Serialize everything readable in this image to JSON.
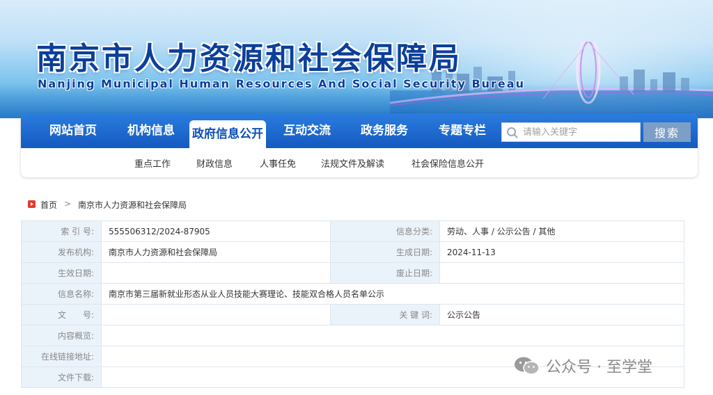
{
  "banner": {
    "title": "南京市人力资源和社会保障局",
    "subtitle": "Nanjing Municipal Human Resources And Social Security Bureau"
  },
  "nav": {
    "items": [
      "网站首页",
      "机构信息",
      "政府信息公开",
      "互动交流",
      "政务服务",
      "专题专栏"
    ],
    "active": "政府信息公开",
    "search_placeholder": "请输入关键字",
    "search_button": "搜索"
  },
  "subnav": {
    "items": [
      "重点工作",
      "财政信息",
      "人事任免",
      "法规文件及解读",
      "社会保险信息公开"
    ]
  },
  "breadcrumb": {
    "home": "首页",
    "separator": ">",
    "current": "南京市人力资源和社会保障局"
  },
  "info": {
    "index_label": "索 引 号:",
    "index_value": "555506312/2024-87905",
    "category_label": "信息分类:",
    "category_value": "劳动、人事 / 公示公告 / 其他",
    "publisher_label": "发布机构:",
    "publisher_value": "南京市人力资源和社会保障局",
    "date_label": "生成日期:",
    "date_value": "2024-11-13",
    "effective_label": "生效日期:",
    "effective_value": "",
    "expire_label": "废止日期:",
    "expire_value": "",
    "name_label": "信息名称:",
    "name_value": "南京市第三届新就业形态从业人员技能大赛理论、技能双合格人员名单公示",
    "docno_label": "文　　号:",
    "docno_value": "",
    "keyword_label": "关 键 词:",
    "keyword_value": "公示公告",
    "summary_label": "内容概览:",
    "summary_value": "",
    "link_label": "在线链接地址:",
    "link_value": "",
    "download_label": "文件下载:",
    "download_value": ""
  },
  "watermark": {
    "text": "公众号 · 至学堂"
  },
  "colors": {
    "nav_blue": "#1a66cc",
    "label_bg": "#eaf2fa",
    "title_blue": "#0b3f9a",
    "home_icon_red": "#e03b2e"
  }
}
